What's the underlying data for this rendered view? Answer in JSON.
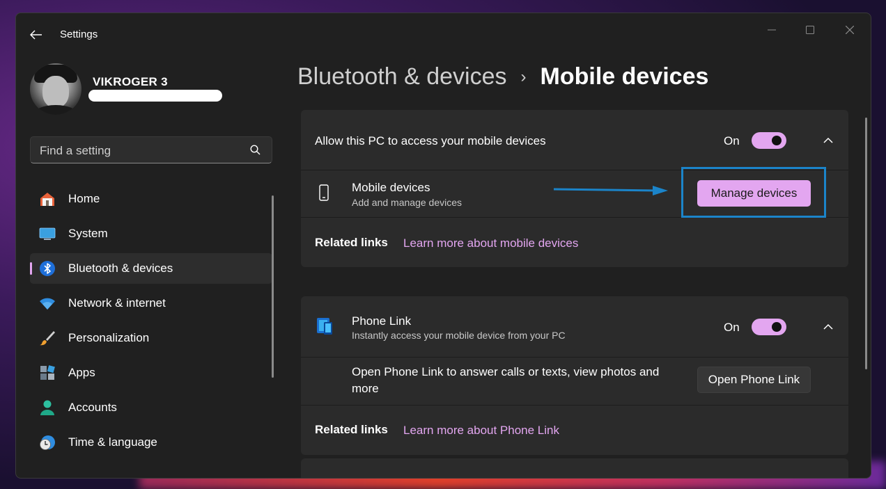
{
  "window": {
    "title": "Settings"
  },
  "user": {
    "name": "VIKROGER 3"
  },
  "search": {
    "placeholder": "Find a setting"
  },
  "sidebar": {
    "items": [
      {
        "label": "Home",
        "icon": "home-icon"
      },
      {
        "label": "System",
        "icon": "system-icon"
      },
      {
        "label": "Bluetooth & devices",
        "icon": "bluetooth-icon",
        "active": true
      },
      {
        "label": "Network & internet",
        "icon": "wifi-icon"
      },
      {
        "label": "Personalization",
        "icon": "brush-icon"
      },
      {
        "label": "Apps",
        "icon": "apps-icon"
      },
      {
        "label": "Accounts",
        "icon": "accounts-icon"
      },
      {
        "label": "Time & language",
        "icon": "clock-globe-icon"
      }
    ]
  },
  "breadcrumb": {
    "parent": "Bluetooth & devices",
    "separator": "›",
    "current": "Mobile devices"
  },
  "mobile_card": {
    "header_label": "Allow this PC to access your mobile devices",
    "toggle_state": "On",
    "row_title": "Mobile devices",
    "row_subtitle": "Add and manage devices",
    "button_label": "Manage devices",
    "related_label": "Related links",
    "related_link": "Learn more about mobile devices"
  },
  "phone_link_card": {
    "title": "Phone Link",
    "subtitle": "Instantly access your mobile device from your PC",
    "toggle_state": "On",
    "description_line1": "Open Phone Link to answer calls or texts, view photos and",
    "description_line2": "more",
    "button_label": "Open Phone Link",
    "related_label": "Related links",
    "related_link": "Learn more about Phone Link"
  },
  "colors": {
    "accent": "#e3a6f0",
    "annotation": "#1b84c9",
    "window_bg": "#202020",
    "card_bg": "#2b2b2b"
  }
}
